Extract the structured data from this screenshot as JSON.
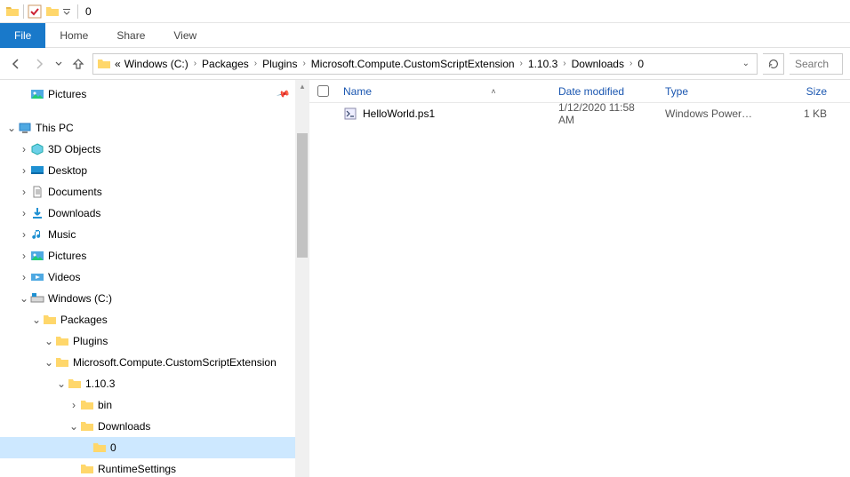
{
  "window": {
    "title": "0"
  },
  "ribbon": {
    "file": "File",
    "tabs": [
      "Home",
      "Share",
      "View"
    ]
  },
  "breadcrumbs": {
    "prefix": "«",
    "items": [
      "Windows (C:)",
      "Packages",
      "Plugins",
      "Microsoft.Compute.CustomScriptExtension",
      "1.10.3",
      "Downloads",
      "0"
    ]
  },
  "search": {
    "placeholder": "Search"
  },
  "columns": {
    "name": "Name",
    "date": "Date modified",
    "type": "Type",
    "size": "Size"
  },
  "pictures_label": "Pictures",
  "tree": {
    "this_pc": "This PC",
    "objects3d": "3D Objects",
    "desktop": "Desktop",
    "documents": "Documents",
    "downloads": "Downloads",
    "music": "Music",
    "pictures": "Pictures",
    "videos": "Videos",
    "cdrive": "Windows (C:)",
    "packages": "Packages",
    "plugins": "Plugins",
    "ext": "Microsoft.Compute.CustomScriptExtension",
    "ver": "1.10.3",
    "bin": "bin",
    "tdownloads": "Downloads",
    "zero": "0",
    "runtime": "RuntimeSettings"
  },
  "files": [
    {
      "name": "HelloWorld.ps1",
      "date": "1/12/2020 11:58 AM",
      "type": "Windows PowerS...",
      "size": "1 KB"
    }
  ]
}
